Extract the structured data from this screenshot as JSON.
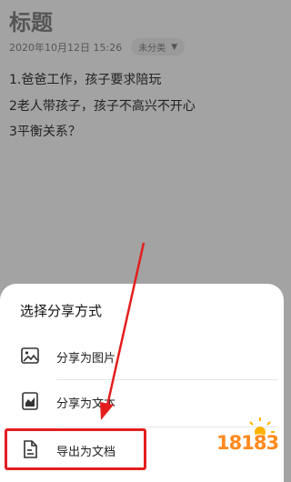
{
  "note": {
    "title": "标题",
    "date": "2020年10月12日 15:26",
    "category": "未分类",
    "lines": [
      "1.爸爸工作，孩子要求陪玩",
      "2老人带孩子，孩子不高兴不开心",
      "3平衡关系？"
    ]
  },
  "share_sheet": {
    "title": "选择分享方式",
    "options": [
      {
        "label": "分享为图片",
        "icon": "image-icon"
      },
      {
        "label": "分享为文本",
        "icon": "text-doc-icon"
      },
      {
        "label": "导出为文档",
        "icon": "document-icon"
      }
    ]
  },
  "watermark": {
    "text": "18183"
  },
  "colors": {
    "highlight": "#e41e1e",
    "watermark": "#ff8a1e"
  }
}
